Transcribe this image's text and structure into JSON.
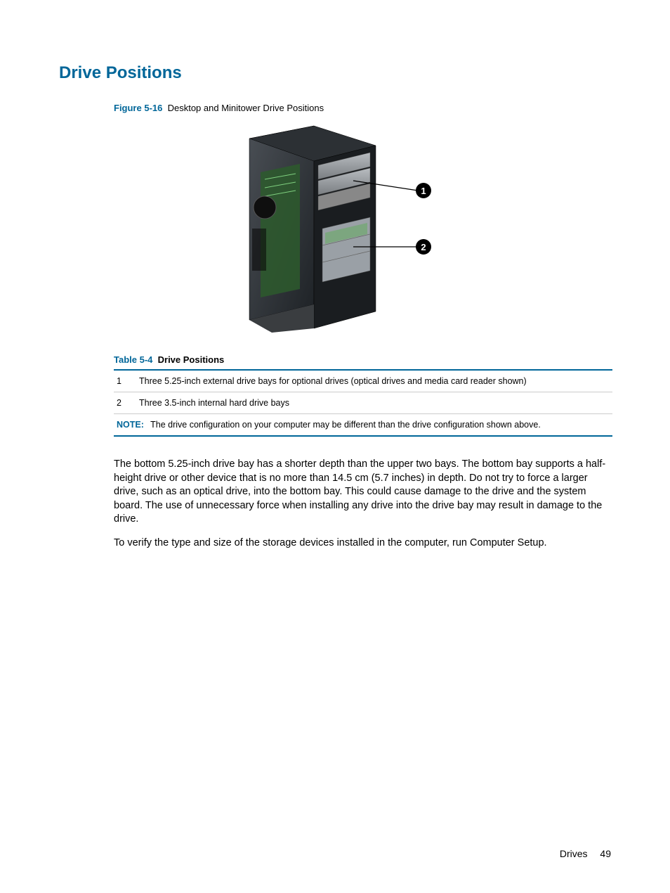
{
  "heading": "Drive Positions",
  "figure": {
    "label": "Figure 5-16",
    "caption": "Desktop and Minitower Drive Positions"
  },
  "table": {
    "label": "Table 5-4",
    "caption": "Drive Positions",
    "rows": [
      {
        "idx": "1",
        "desc": "Three 5.25-inch external drive bays for optional drives (optical drives and media card reader shown)"
      },
      {
        "idx": "2",
        "desc": "Three 3.5-inch internal hard drive bays"
      }
    ],
    "note_label": "NOTE:",
    "note_text": "The drive configuration on your computer may be different than the drive configuration shown above."
  },
  "paragraphs": [
    "The bottom 5.25-inch drive bay has a shorter depth than the upper two bays. The bottom bay supports a half-height drive or other device that is no more than 14.5 cm (5.7 inches) in depth. Do not try to force a larger drive, such as an optical drive, into the bottom bay. This could cause damage to the drive and the system board. The use of unnecessary force when installing any drive into the drive bay may result in damage to the drive.",
    "To verify the type and size of the storage devices installed in the computer, run Computer Setup."
  ],
  "footer": {
    "section": "Drives",
    "page": "49"
  },
  "callouts": {
    "c1": "1",
    "c2": "2"
  }
}
